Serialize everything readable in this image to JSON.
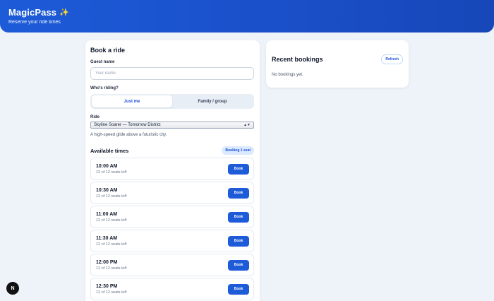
{
  "app": {
    "title": "MagicPass",
    "title_icon": "sparkles",
    "tagline": "Reserve your ride times"
  },
  "booking": {
    "title": "Book a ride",
    "guest_label": "Guest name",
    "guest_placeholder": "Your name",
    "guest_value": "",
    "riding_label": "Who's riding?",
    "riding_options": [
      "Just me",
      "Family / group"
    ],
    "riding_selected": "Just me",
    "ride_label": "Ride",
    "ride_selected": "Skyline Soarer — Tomorrow District",
    "ride_description": "A high-speed glide above a futuristic city.",
    "available_title": "Available times",
    "booking_badge": "Booking 1 seat",
    "book_label": "Book",
    "slots": [
      {
        "time": "10:00 AM",
        "seats": "12 of 12 seats left"
      },
      {
        "time": "10:30 AM",
        "seats": "12 of 12 seats left"
      },
      {
        "time": "11:00 AM",
        "seats": "12 of 12 seats left"
      },
      {
        "time": "11:30 AM",
        "seats": "12 of 12 seats left"
      },
      {
        "time": "12:00 PM",
        "seats": "12 of 12 seats left"
      },
      {
        "time": "12:30 PM",
        "seats": "12 of 12 seats left"
      }
    ]
  },
  "recent": {
    "title": "Recent bookings",
    "refresh_label": "Refresh",
    "empty_text": "No bookings yet."
  },
  "fab": {
    "label": "N"
  },
  "colors": {
    "header_blue": "#1d5bd8",
    "accent": "#1d4ed8",
    "background": "#eef2f9"
  }
}
